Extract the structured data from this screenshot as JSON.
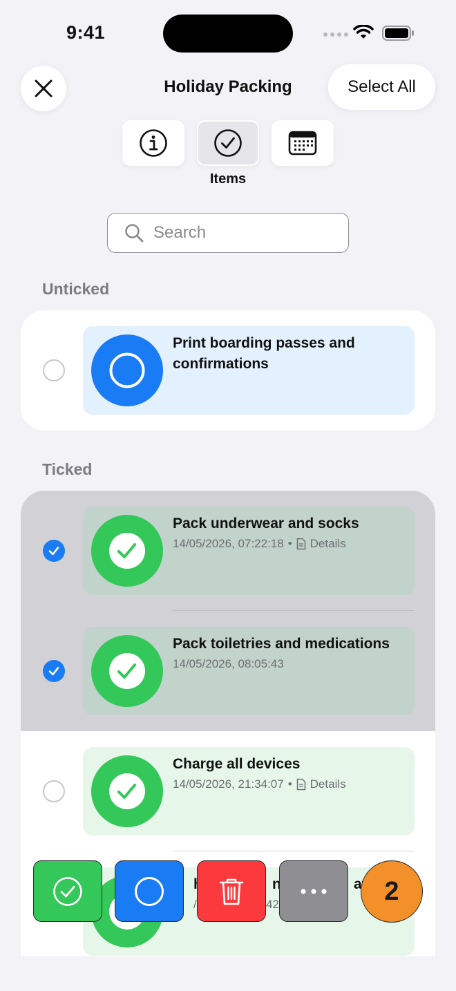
{
  "status_bar": {
    "time": "9:41"
  },
  "header": {
    "title": "Holiday Packing",
    "select_all_label": "Select All"
  },
  "segments": [
    {
      "icon": "info-icon"
    },
    {
      "icon": "checkmark-circle-icon",
      "label": "Items",
      "active": true
    },
    {
      "icon": "calendar-icon"
    }
  ],
  "search": {
    "placeholder": "Search"
  },
  "sections": {
    "unticked": {
      "title": "Unticked",
      "items": [
        {
          "title": "Print boarding passes and confirmations",
          "checked": false
        }
      ]
    },
    "ticked": {
      "title": "Ticked",
      "items": [
        {
          "title": "Pack underwear and socks",
          "date": "14/05/2026, 07:22:18",
          "details_label": "Details",
          "selected": true
        },
        {
          "title": "Pack toiletries and medications",
          "date": "14/05/2026, 08:05:43",
          "selected": true
        },
        {
          "title": "Charge all devices",
          "date": "14/05/2026, 21:34:07",
          "details_label": "Details",
          "selected": false
        },
        {
          "title_fragment_a": "he",
          "title_fragment_b": "ner",
          "title_fragment_c": "at",
          "sub_fragment_a": "/0",
          "sub_fragment_b": "42"
        }
      ]
    }
  },
  "toolbar": {
    "selected_count": "2",
    "buttons": [
      "tick-icon",
      "untick-icon",
      "trash-icon",
      "more-icon"
    ]
  },
  "colors": {
    "accent_blue": "#1a7cf5",
    "green": "#34c759",
    "red": "#ff3b30",
    "gray": "#8e8e93",
    "orange": "#f39029"
  }
}
